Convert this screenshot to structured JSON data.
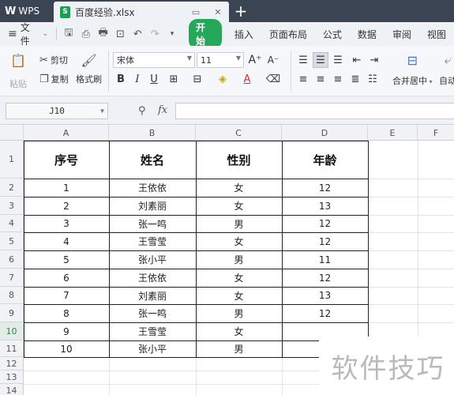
{
  "titlebar": {
    "app_name": "WPS",
    "doc_icon_letter": "S",
    "doc_name": "百度经验.xlsx"
  },
  "menubar": {
    "file_label": "文件",
    "start_label": "开始",
    "items": [
      "插入",
      "页面布局",
      "公式",
      "数据",
      "审阅",
      "视图"
    ]
  },
  "ribbon": {
    "paste_label": "粘贴",
    "cut_label": "剪切",
    "copy_label": "复制",
    "format_painter_label": "格式刷",
    "font_name": "宋体",
    "font_size": "11",
    "merge_center_label": "合并居中",
    "auto_wrap_label": "自动"
  },
  "formula": {
    "cell_ref": "J10",
    "fx_label": "fx",
    "value": ""
  },
  "columns": [
    "A",
    "B",
    "C",
    "D",
    "E",
    "F"
  ],
  "rows": [
    "1",
    "2",
    "3",
    "4",
    "5",
    "6",
    "7",
    "8",
    "9",
    "10",
    "11",
    "12",
    "13",
    "14"
  ],
  "table": {
    "headers": [
      "序号",
      "姓名",
      "性别",
      "年龄"
    ],
    "rows": [
      [
        "1",
        "王依依",
        "女",
        "12"
      ],
      [
        "2",
        "刘素丽",
        "女",
        "13"
      ],
      [
        "3",
        "张一鸣",
        "男",
        "12"
      ],
      [
        "4",
        "王雪莹",
        "女",
        "12"
      ],
      [
        "5",
        "张小平",
        "男",
        "11"
      ],
      [
        "6",
        "王依依",
        "女",
        "12"
      ],
      [
        "7",
        "刘素丽",
        "女",
        "13"
      ],
      [
        "8",
        "张一鸣",
        "男",
        "12"
      ],
      [
        "9",
        "王雪莹",
        "女",
        ""
      ],
      [
        "10",
        "张小平",
        "男",
        ""
      ]
    ]
  },
  "watermark": "软件技巧",
  "colors": {
    "titlebar_bg": "#3a4452",
    "start_button": "#26a85a",
    "active_row_text": "#1f8a4c"
  }
}
